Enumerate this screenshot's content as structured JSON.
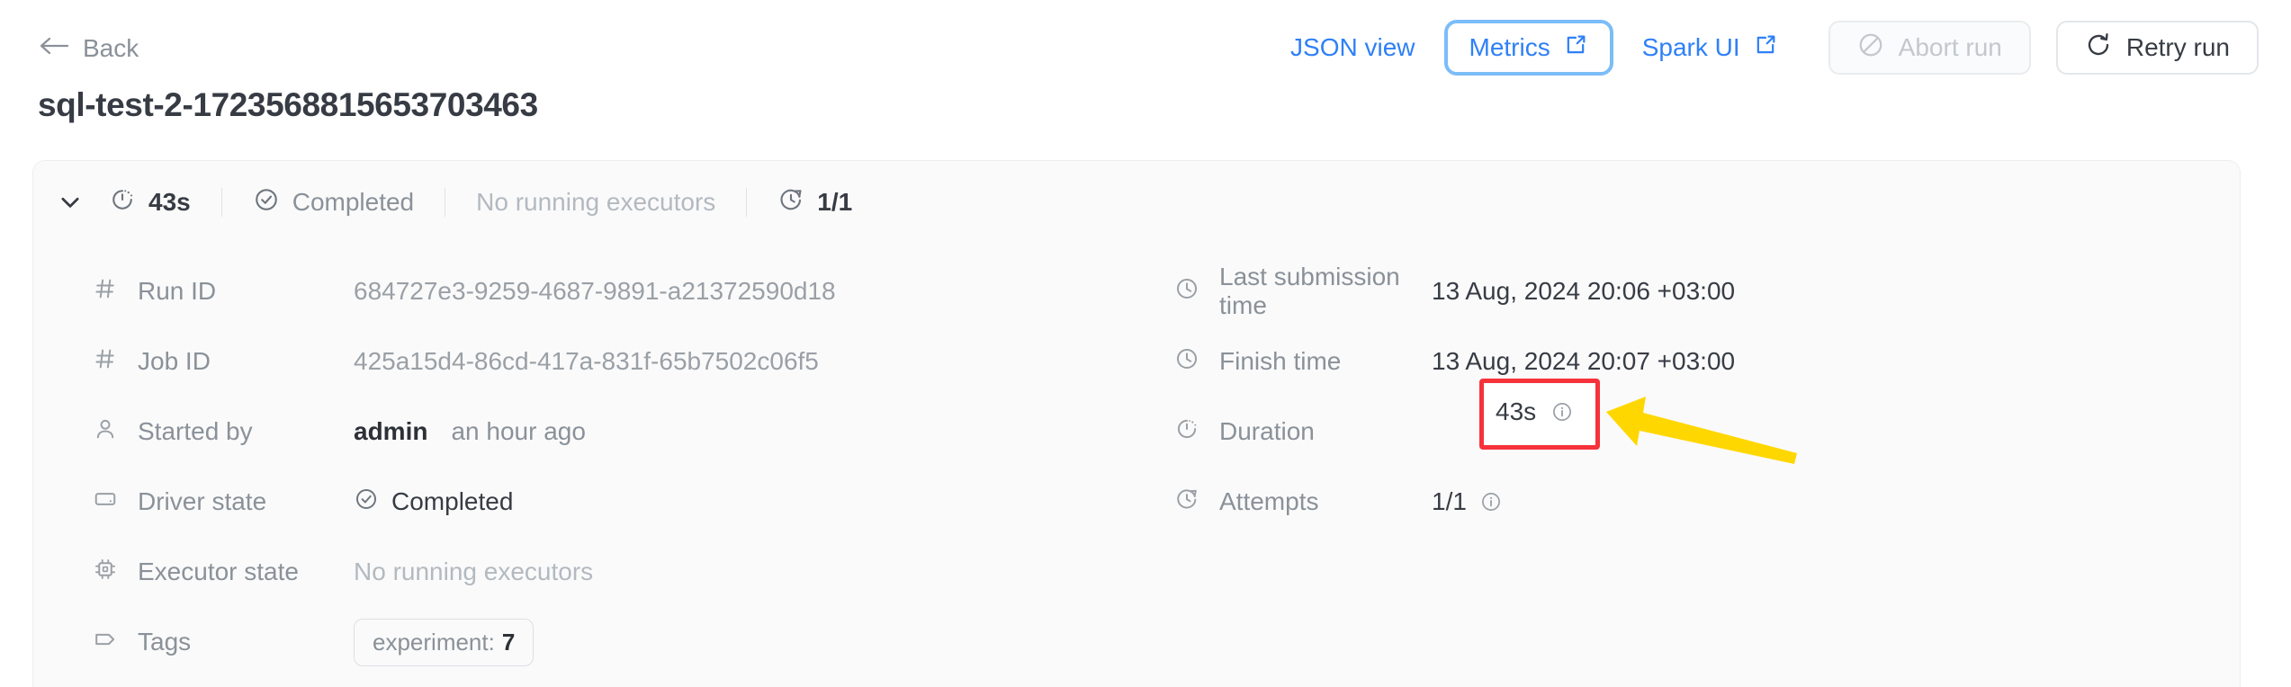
{
  "header": {
    "back_label": "Back",
    "title": "sql-test-2-1723568815653703463",
    "actions": {
      "json_view": "JSON view",
      "metrics": "Metrics",
      "spark_ui": "Spark UI",
      "abort_run": "Abort run",
      "retry_run": "Retry run"
    }
  },
  "status_bar": {
    "duration": "43s",
    "state": "Completed",
    "executors": "No running executors",
    "attempts": "1/1"
  },
  "details_left": [
    {
      "icon": "hash-icon",
      "label": "Run ID",
      "value": "684727e3-9259-4687-9891-a21372590d18"
    },
    {
      "icon": "hash-icon",
      "label": "Job ID",
      "value": "425a15d4-86cd-417a-831f-65b7502c06f5"
    },
    {
      "icon": "user-icon",
      "label": "Started by",
      "value": "admin",
      "value_extra": "an hour ago"
    },
    {
      "icon": "display-icon",
      "label": "Driver state",
      "value": "Completed"
    },
    {
      "icon": "cpu-chip-icon",
      "label": "Executor state",
      "value": "No running executors"
    },
    {
      "icon": "tag-icon",
      "label": "Tags",
      "tag_key": "experiment:",
      "tag_value": "7"
    }
  ],
  "details_right": [
    {
      "icon": "clock-icon",
      "label": "Last submission time",
      "value": "13 Aug, 2024 20:06 +03:00"
    },
    {
      "icon": "clock-icon",
      "label": "Finish time",
      "value": "13 Aug, 2024 20:07 +03:00"
    },
    {
      "icon": "stopwatch-icon",
      "label": "Duration",
      "value": "43s"
    },
    {
      "icon": "retry-clock-icon",
      "label": "Attempts",
      "value": "1/1"
    }
  ],
  "colors": {
    "link_blue": "#2f80f7",
    "focus_ring": "#7bbdf8",
    "annotation_red": "#f6323b",
    "annotation_yellow": "#ffd700",
    "text_dark": "#373c44",
    "text_muted": "#8a9199",
    "card_bg": "#fafafa"
  }
}
